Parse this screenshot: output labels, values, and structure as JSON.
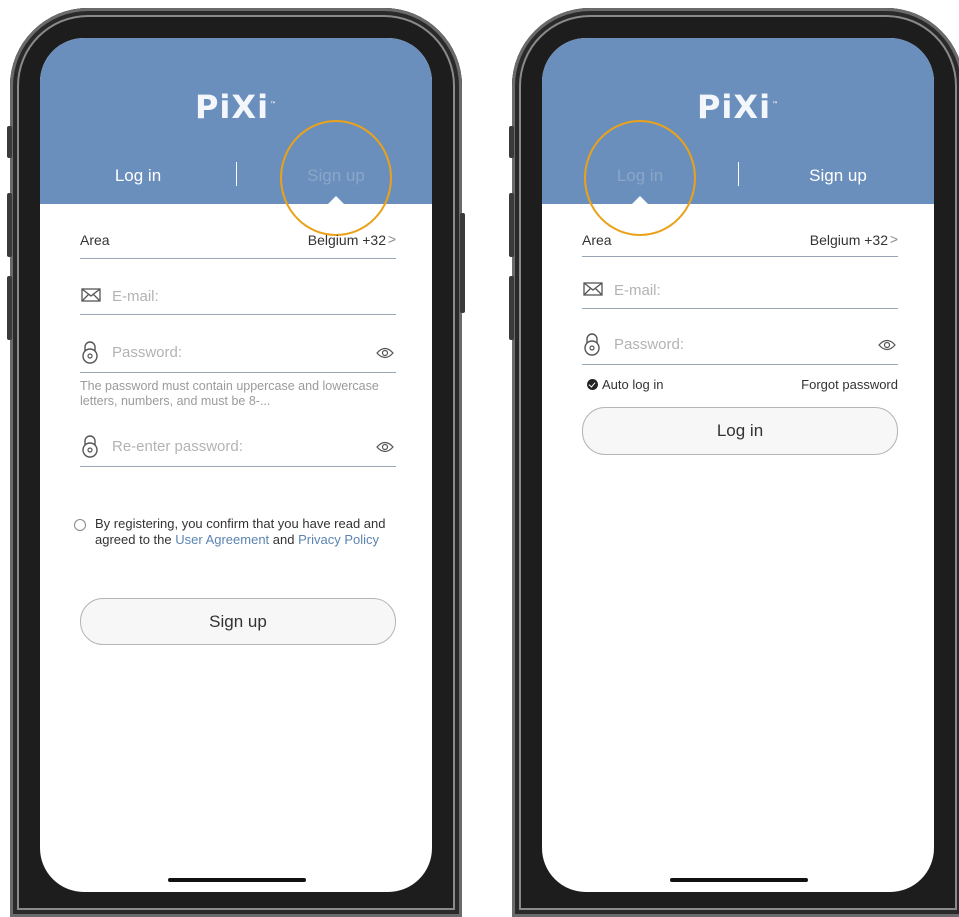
{
  "signup_screen": {
    "logo": "PiXi",
    "trademark": "™",
    "tabs": {
      "login": "Log in",
      "signup": "Sign up"
    },
    "area": {
      "label": "Area",
      "value": "Belgium +32",
      "chevron": ">"
    },
    "email": {
      "placeholder": "E-mail:"
    },
    "password": {
      "placeholder": "Password:"
    },
    "password_hint": "The password must contain uppercase and lowercase letters, numbers, and must be 8-...",
    "reenter_password": {
      "placeholder": "Re-enter password:"
    },
    "agreement": {
      "prefix": "By registering, you confirm that you have read and agreed to the ",
      "user_agreement": "User Agreement",
      "and": " and ",
      "privacy_policy": "Privacy Policy"
    },
    "submit_label": "Sign up",
    "active_tab": "Sign up"
  },
  "login_screen": {
    "logo": "PiXi",
    "trademark": "™",
    "tabs": {
      "login": "Log in",
      "signup": "Sign up"
    },
    "area": {
      "label": "Area",
      "value": "Belgium +32",
      "chevron": ">"
    },
    "email": {
      "placeholder": "E-mail:"
    },
    "password": {
      "placeholder": "Password:"
    },
    "auto_login": "Auto log in",
    "forgot_password": "Forgot password",
    "submit_label": "Log in",
    "active_tab": "Log in"
  },
  "colors": {
    "header_blue": "#6b8fbc",
    "highlight_ring": "#e9a21a",
    "link": "#5b84b1"
  },
  "icons": [
    "envelope-icon",
    "lock-icon",
    "eye-icon",
    "chevron-right-icon",
    "checkmark-icon",
    "radio-icon"
  ]
}
